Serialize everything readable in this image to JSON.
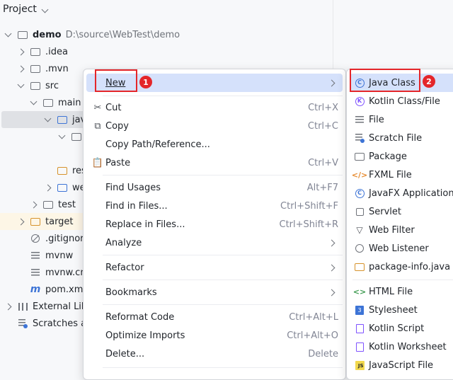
{
  "project_header": {
    "title": "Project"
  },
  "tree": {
    "root_name": "demo",
    "root_path": "D:\\source\\WebTest\\demo",
    "items": [
      {
        "label": ".idea"
      },
      {
        "label": ".mvn"
      },
      {
        "label": "src"
      },
      {
        "label": "main"
      },
      {
        "label": "jav"
      },
      {
        "label": "res"
      },
      {
        "label": "we"
      },
      {
        "label": "test"
      },
      {
        "label": "target"
      },
      {
        "label": ".gitignore"
      },
      {
        "label": "mvnw"
      },
      {
        "label": "mvnw.cmd"
      },
      {
        "label": "pom.xml"
      },
      {
        "label": "External Libraries"
      },
      {
        "label": "Scratches and Consoles"
      }
    ]
  },
  "context_menu": {
    "new": {
      "label": "New",
      "badge": "1"
    },
    "cut": {
      "label": "Cut",
      "shortcut": "Ctrl+X"
    },
    "copy": {
      "label": "Copy",
      "shortcut": "Ctrl+C"
    },
    "copy_path": {
      "label": "Copy Path/Reference..."
    },
    "paste": {
      "label": "Paste",
      "shortcut": "Ctrl+V"
    },
    "find_usages": {
      "label": "Find Usages",
      "shortcut": "Alt+F7"
    },
    "find_in_files": {
      "label": "Find in Files...",
      "shortcut": "Ctrl+Shift+F"
    },
    "replace_in_files": {
      "label": "Replace in Files...",
      "shortcut": "Ctrl+Shift+R"
    },
    "analyze": {
      "label": "Analyze"
    },
    "refactor": {
      "label": "Refactor"
    },
    "bookmarks": {
      "label": "Bookmarks"
    },
    "reformat": {
      "label": "Reformat Code",
      "shortcut": "Ctrl+Alt+L"
    },
    "optimize": {
      "label": "Optimize Imports",
      "shortcut": "Ctrl+Alt+O"
    },
    "delete": {
      "label": "Delete...",
      "shortcut": "Delete"
    }
  },
  "new_submenu": {
    "java_class": {
      "label": "Java Class",
      "badge": "2"
    },
    "kotlin_class": {
      "label": "Kotlin Class/File"
    },
    "file": {
      "label": "File"
    },
    "scratch_file": {
      "label": "Scratch File"
    },
    "package": {
      "label": "Package"
    },
    "fxml_file": {
      "label": "FXML File"
    },
    "javafx_app": {
      "label": "JavaFX Application"
    },
    "servlet": {
      "label": "Servlet"
    },
    "web_filter": {
      "label": "Web Filter"
    },
    "web_listener": {
      "label": "Web Listener"
    },
    "package_info": {
      "label": "package-info.java"
    },
    "html_file": {
      "label": "HTML File"
    },
    "stylesheet": {
      "label": "Stylesheet"
    },
    "kotlin_script": {
      "label": "Kotlin Script"
    },
    "kotlin_worksheet": {
      "label": "Kotlin Worksheet"
    },
    "javascript_file": {
      "label": "JavaScript File"
    }
  },
  "colors": {
    "selection": "#d5e1fb",
    "annotation": "#e4262a",
    "accent": "#3d74d6"
  }
}
